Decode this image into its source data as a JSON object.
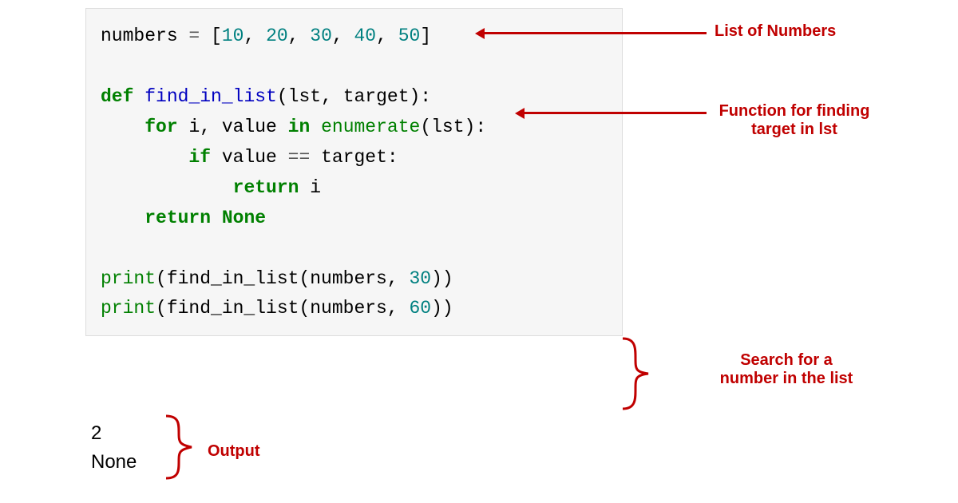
{
  "code": {
    "line1_name": "numbers ",
    "line1_op": "=",
    "line1_open": " [",
    "line1_n1": "10",
    "line1_c": ", ",
    "line1_n2": "20",
    "line1_n3": "30",
    "line1_n4": "40",
    "line1_n5": "50",
    "line1_close": "]",
    "blank": "",
    "line3_def": "def",
    "line3_sp": " ",
    "line3_fn": "find_in_list",
    "line3_args": "(lst, target):",
    "line4_indent": "    ",
    "line4_for": "for",
    "line4_mid": " i, value ",
    "line4_in": "in",
    "line4_sp2": " ",
    "line4_enum": "enumerate",
    "line4_tail": "(lst):",
    "line5_indent": "        ",
    "line5_if": "if",
    "line5_val": " value ",
    "line5_eq": "==",
    "line5_tgt": " target:",
    "line6_indent": "            ",
    "line6_ret": "return",
    "line6_i": " i",
    "line7_indent": "    ",
    "line7_ret": "return",
    "line7_sp": " ",
    "line7_none": "None",
    "line9_print": "print",
    "line9_open": "(find_in_list(numbers, ",
    "line9_num": "30",
    "line9_close": "))",
    "line10_print": "print",
    "line10_open": "(find_in_list(numbers, ",
    "line10_num": "60",
    "line10_close": "))"
  },
  "output": {
    "line1": "2",
    "line2": "None"
  },
  "annotations": {
    "a1": "List of Numbers",
    "a2": "Function for finding target in lst",
    "a3": "Search for a number in the list",
    "a4": "Output"
  }
}
